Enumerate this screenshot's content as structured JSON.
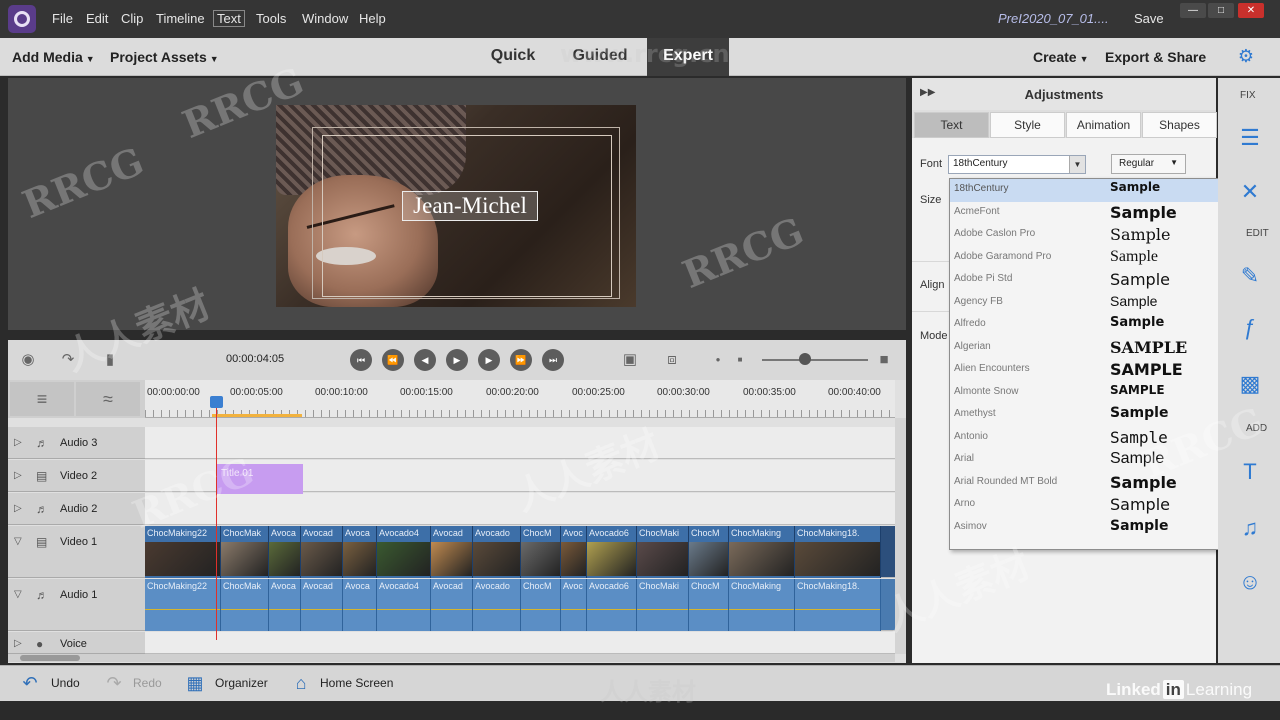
{
  "menubar": {
    "items": [
      "File",
      "Edit",
      "Clip",
      "Timeline",
      "Text",
      "Tools",
      "Window",
      "Help"
    ],
    "project_name": "PreI2020_07_01....",
    "save_label": "Save",
    "window_controls": [
      "minimize-icon",
      "maximize-icon",
      "close-icon"
    ]
  },
  "toolbar": {
    "add_media": "Add Media",
    "project_assets": "Project Assets",
    "modes": [
      "Quick",
      "Guided",
      "Expert"
    ],
    "active_mode": "Expert",
    "create": "Create",
    "export_share": "Export & Share",
    "settings_icon": "gear-icon"
  },
  "monitor": {
    "title_text": "Jean-Michel"
  },
  "transport": {
    "timecode": "00:00:04:05",
    "controls": [
      "go-to-start-icon",
      "step-back-icon",
      "rewind-icon",
      "play-icon",
      "forward-icon",
      "step-forward-icon",
      "go-to-end-icon"
    ]
  },
  "timeline": {
    "ruler_labels": [
      "00:00:00:00",
      "00:00:05:00",
      "00:00:10:00",
      "00:00:15:00",
      "00:00:20:00",
      "00:00:25:00",
      "00:00:30:00",
      "00:00:35:00",
      "00:00:40:00"
    ],
    "tracks": [
      {
        "name": "Audio 3",
        "kind": "audio"
      },
      {
        "name": "Video 2",
        "kind": "video"
      },
      {
        "name": "Audio 2",
        "kind": "audio"
      },
      {
        "name": "Video 1",
        "kind": "video"
      },
      {
        "name": "Audio 1",
        "kind": "audio"
      },
      {
        "name": "Voice",
        "kind": "audio"
      }
    ],
    "title_clip_label": "Title 01",
    "video_clips": [
      "ChocMaking22",
      "ChocMak",
      "Avoca",
      "Avocad",
      "Avoca",
      "Avocado4",
      "Avocad",
      "Avocado",
      "ChocM",
      "Avoc",
      "Avocado6",
      "ChocMaki",
      "ChocM",
      "ChocMaking",
      "ChocMaking18."
    ],
    "audio_clips": [
      "ChocMaking22",
      "ChocMak",
      "Avoca",
      "Avocad",
      "Avoca",
      "Avocado4",
      "Avocad",
      "Avocado",
      "ChocM",
      "Avoc",
      "Avocado6",
      "ChocMaki",
      "ChocM",
      "ChocMaking",
      "ChocMaking18."
    ]
  },
  "bottombar": {
    "undo": "Undo",
    "redo": "Redo",
    "organizer": "Organizer",
    "home_screen": "Home Screen"
  },
  "adjustments": {
    "title": "Adjustments",
    "tabs": [
      "Text",
      "Style",
      "Animation",
      "Shapes"
    ],
    "active_tab": "Text",
    "font_label": "Font",
    "size_label": "Size",
    "align_label": "Align",
    "mode_label": "Mode",
    "font_value": "18thCentury",
    "style_value": "Regular",
    "font_list": [
      {
        "name": "18thCentury",
        "sample": "Sample"
      },
      {
        "name": "AcmeFont",
        "sample": "Sample"
      },
      {
        "name": "Adobe Caslon Pro",
        "sample": "Sample"
      },
      {
        "name": "Adobe Garamond Pro",
        "sample": "Sample"
      },
      {
        "name": "Adobe Pi Std",
        "sample": "Sample"
      },
      {
        "name": "Agency FB",
        "sample": "Sample"
      },
      {
        "name": "Alfredo",
        "sample": "Sample"
      },
      {
        "name": "Algerian",
        "sample": "SAMPLE"
      },
      {
        "name": "Alien Encounters",
        "sample": "SAMPLE"
      },
      {
        "name": "Almonte Snow",
        "sample": "SAMPLE"
      },
      {
        "name": "Amethyst",
        "sample": "Sample"
      },
      {
        "name": "Antonio",
        "sample": "Sample"
      },
      {
        "name": "Arial",
        "sample": "Sample"
      },
      {
        "name": "Arial Rounded MT Bold",
        "sample": "Sample"
      },
      {
        "name": "Arno",
        "sample": "Sample"
      },
      {
        "name": "Asimov",
        "sample": "Sample"
      }
    ]
  },
  "rightstrip": {
    "fix_label": "FIX",
    "edit_label": "EDIT",
    "add_label": "ADD"
  },
  "watermark": {
    "rrcg": "RRCG",
    "site": "www.rrcg.cn",
    "cn": "人人素材",
    "linkedin_a": "Linked",
    "linkedin_in": "in",
    "linkedin_b": "Learning"
  }
}
